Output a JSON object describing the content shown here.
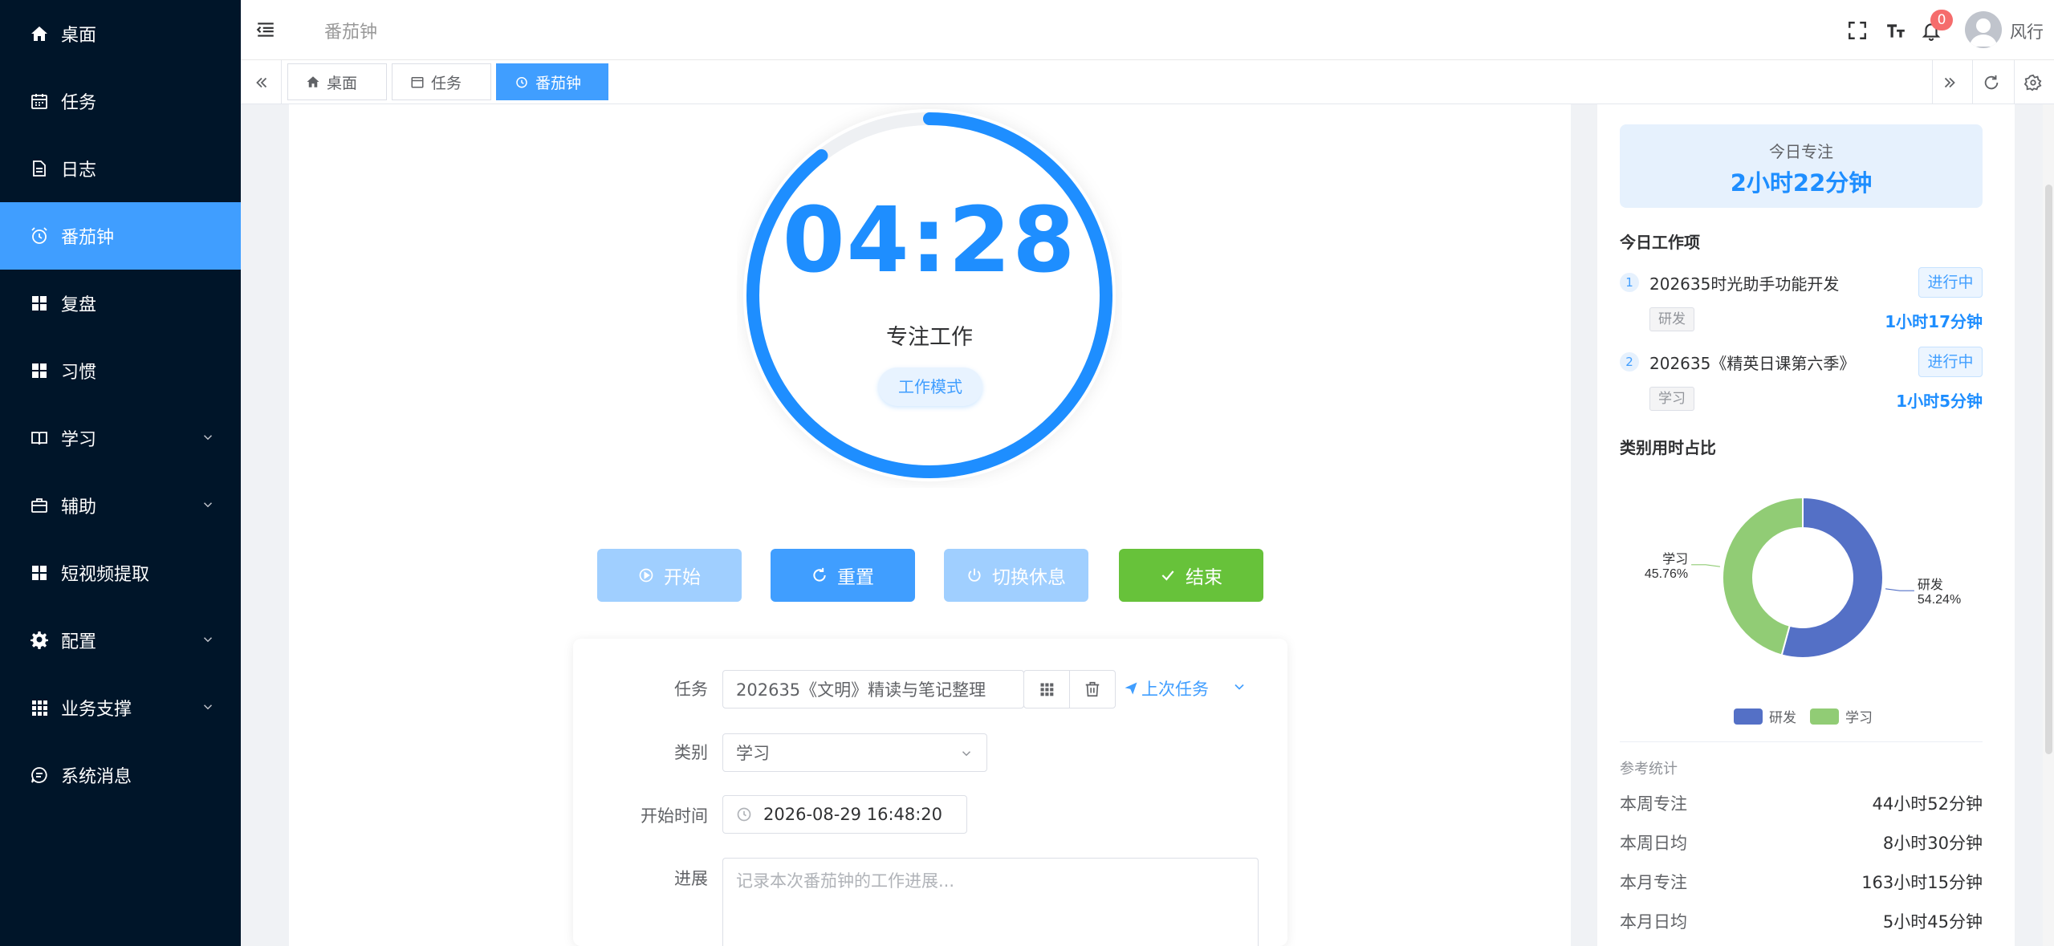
{
  "sidebar": {
    "items": [
      {
        "label": "桌面",
        "icon": "home-icon"
      },
      {
        "label": "任务",
        "icon": "calendar-icon"
      },
      {
        "label": "日志",
        "icon": "document-icon"
      },
      {
        "label": "番茄钟",
        "icon": "alarm-clock-icon",
        "active": true
      },
      {
        "label": "复盘",
        "icon": "grid-icon"
      },
      {
        "label": "习惯",
        "icon": "grid-icon"
      },
      {
        "label": "学习",
        "icon": "book-icon",
        "expandable": true
      },
      {
        "label": "辅助",
        "icon": "briefcase-icon",
        "expandable": true
      },
      {
        "label": "短视频提取",
        "icon": "grid-icon"
      },
      {
        "label": "配置",
        "icon": "gear-icon",
        "expandable": true
      },
      {
        "label": "业务支撑",
        "icon": "apps-icon",
        "expandable": true
      },
      {
        "label": "系统消息",
        "icon": "chat-icon"
      }
    ]
  },
  "header": {
    "title": "番茄钟",
    "notification_count": "0",
    "username": "风行"
  },
  "tabs": [
    {
      "label": "桌面",
      "icon": "home-icon"
    },
    {
      "label": "任务",
      "icon": "calendar-icon"
    },
    {
      "label": "番茄钟",
      "icon": "alarm-clock-icon",
      "active": true
    }
  ],
  "timer": {
    "time": "04:28",
    "label": "专注工作",
    "mode": "工作模式",
    "progress_fraction": 0.895,
    "ring_color": "#1e8eff"
  },
  "buttons": {
    "start": "开始",
    "reset": "重置",
    "rest": "切换休息",
    "end": "结束"
  },
  "form": {
    "task_label": "任务",
    "task_value": "202635《文明》精读与笔记整理",
    "last_task_link": "上次任务",
    "category_label": "类别",
    "category_value": "学习",
    "start_label": "开始时间",
    "start_value": "2026-08-29 16:48:20",
    "progress_label": "进展",
    "progress_placeholder": "记录本次番茄钟的工作进展..."
  },
  "right": {
    "focus_label": "今日专注",
    "focus_value": "2小时22分钟",
    "work_items_title": "今日工作项",
    "work_items": [
      {
        "num": "1",
        "title": "202635时光助手功能开发",
        "status": "进行中",
        "tag": "研发",
        "duration": "1小时17分钟"
      },
      {
        "num": "2",
        "title": "202635《精英日课第六季》",
        "status": "进行中",
        "tag": "学习",
        "duration": "1小时5分钟"
      }
    ],
    "ratio_title": "类别用时占比",
    "ref_title": "参考统计",
    "ref_stats": [
      {
        "label": "本周专注",
        "value": "44小时52分钟"
      },
      {
        "label": "本周日均",
        "value": "8小时30分钟"
      },
      {
        "label": "本月专注",
        "value": "163小时15分钟"
      },
      {
        "label": "本月日均",
        "value": "5小时45分钟"
      }
    ]
  },
  "chart_data": {
    "type": "pie",
    "categories": [
      "研发",
      "学习"
    ],
    "values": [
      54.24,
      45.76
    ],
    "labels": [
      "研发",
      "学习"
    ],
    "percent_labels": [
      "54.24%",
      "45.76%"
    ],
    "colors": [
      "#5470c6",
      "#91cc75"
    ],
    "legend_position": "bottom"
  }
}
